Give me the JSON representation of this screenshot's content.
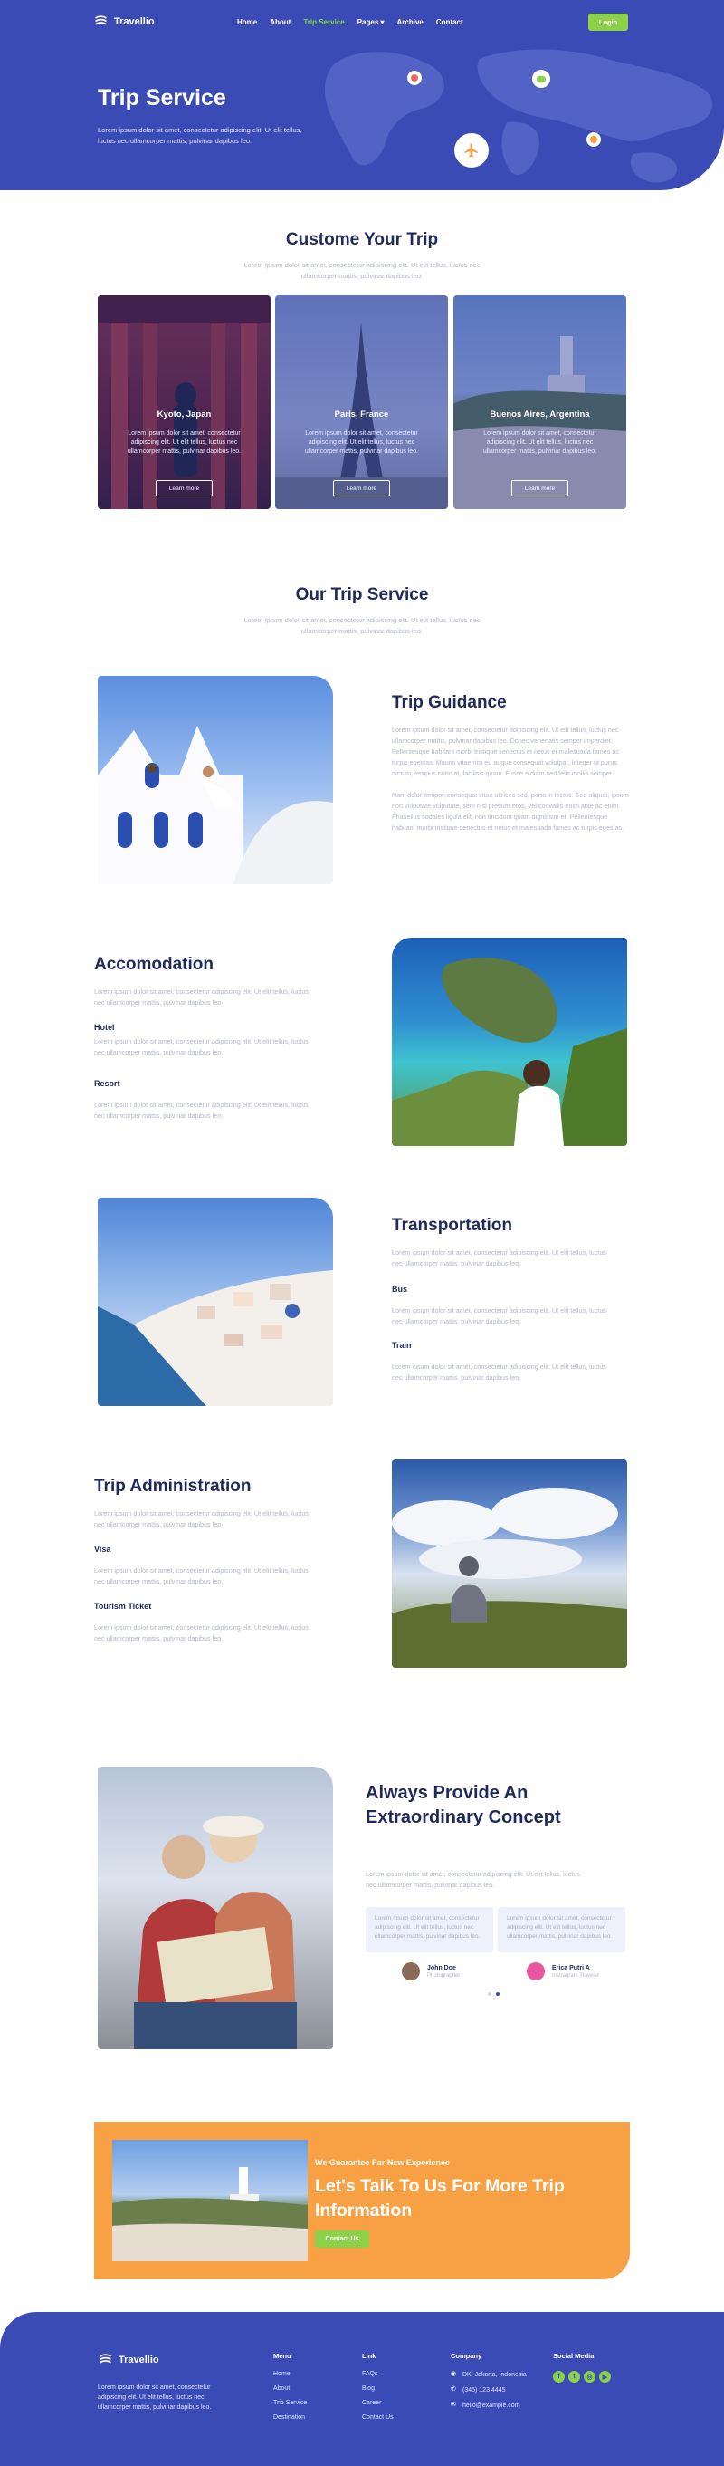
{
  "nav": {
    "brand": "Travellio",
    "links": [
      {
        "label": "Home"
      },
      {
        "label": "About"
      },
      {
        "label": "Trip Service"
      },
      {
        "label": "Pages"
      },
      {
        "label": "Archive"
      },
      {
        "label": "Contact"
      }
    ],
    "active_index": 2,
    "login_label": "Login"
  },
  "hero": {
    "title": "Trip Service",
    "subtitle": "Lorem ipsum dolor sit amet, consectetur adipiscing elit. Ut elit tellus, luctus nec ullamcorper mattis, pulvinar dapibus leo."
  },
  "customize": {
    "title": "Custome Your Trip",
    "subtitle": "Lorem ipsum dolor sit amet, consectetur adipiscing elit. Ut elit tellus, luctus nec ullamcorper mattis, pulvinar dapibus leo.",
    "cards": [
      {
        "title": "Kyoto, Japan",
        "text": "Lorem ipsum dolor sit amet, consectetur adipiscing elit. Ut elit tellus, luctus nec ullamcorper mattis, pulvinar dapibus leo.",
        "button": "Learn more"
      },
      {
        "title": "Paris, France",
        "text": "Lorem ipsum dolor sit amet, consectetur adipiscing elit. Ut elit tellus, luctus nec ullamcorper mattis, pulvinar dapibus leo.",
        "button": "Learn more"
      },
      {
        "title": "Buenos Aires, Argentina",
        "text": "Lorem ipsum dolor sit amet, consectetur adipiscing elit. Ut elit tellus, luctus nec ullamcorper mattis, pulvinar dapibus leo.",
        "button": "Learn more"
      }
    ]
  },
  "services": {
    "title": "Our Trip Service",
    "subtitle": "Lorem ipsum dolor sit amet, consectetur adipiscing elit. Ut elit tellus, luctus nec ullamcorper mattis, pulvinar dapibus leo.",
    "guidance": {
      "title": "Trip Guidance",
      "p1": "Lorem ipsum dolor sit amet, consectetur adipiscing elit. Ut elit tellus, luctus nec ullamcorper mattis, pulvinar dapibus leo. Donec venenatis semper imperdiet. Pellentesque habitant morbi tristique senectus et netus et malesuada fames ac turpis egestas. Mauris vitae nisi eu augue consequat volutpat. Integer ut purus dictum, tempus nunc at, facilisis quam. Fusce a diam sed felis mollis semper.",
      "p2": "Nam dolor tempor, consequat vitae ultrices sed, porta in lectus. Sed aliquet, ipsum non vulputate vulputate, sem nisl pretium eros, vel convallis enim ante ac enim. Phasellus sodales ligula elit, non tincidunt quam dignissim et. Pellentesque habitant morbi tristique senectus et netus et malesuada fames ac turpis egestas."
    },
    "accommodation": {
      "title": "Accomodation",
      "intro": "Lorem ipsum dolor sit amet, consectetur adipiscing elit. Ut elit tellus, luctus nec ullamcorper mattis, pulvinar dapibus leo.",
      "items": [
        {
          "label": "Hotel",
          "text": "Lorem ipsum dolor sit amet, consectetur adipiscing elit. Ut elit tellus, luctus nec ullamcorper mattis, pulvinar dapibus leo."
        },
        {
          "label": "Resort",
          "text": "Lorem ipsum dolor sit amet, consectetur adipiscing elit. Ut elit tellus, luctus nec ullamcorper mattis, pulvinar dapibus leo."
        }
      ]
    },
    "transportation": {
      "title": "Transportation",
      "intro": "Lorem ipsum dolor sit amet, consectetur adipiscing elit. Ut elit tellus, luctus nec ullamcorper mattis, pulvinar dapibus leo.",
      "items": [
        {
          "label": "Bus",
          "text": "Lorem ipsum dolor sit amet, consectetur adipiscing elit. Ut elit tellus, luctus nec ullamcorper mattis, pulvinar dapibus leo."
        },
        {
          "label": "Train",
          "text": "Lorem ipsum dolor sit amet, consectetur adipiscing elit. Ut elit tellus, luctus nec ullamcorper mattis, pulvinar dapibus leo."
        }
      ]
    },
    "administration": {
      "title": "Trip Administration",
      "intro": "Lorem ipsum dolor sit amet, consectetur adipiscing elit. Ut elit tellus, luctus nec ullamcorper mattis, pulvinar dapibus leo.",
      "items": [
        {
          "label": "Visa",
          "text": "Lorem ipsum dolor sit amet, consectetur adipiscing elit. Ut elit tellus, luctus nec ullamcorper mattis, pulvinar dapibus leo."
        },
        {
          "label": "Tourism Ticket",
          "text": "Lorem ipsum dolor sit amet, consectetur adipiscing elit. Ut elit tellus, luctus nec ullamcorper mattis, pulvinar dapibus leo."
        }
      ]
    }
  },
  "testimonial": {
    "title": "Always Provide An Extraordinary Concept",
    "subtitle": "Lorem ipsum dolor sit amet, consectetur adipiscing elit. Ut elit tellus, luctus nec ullamcorper mattis, pulvinar dapibus leo.",
    "quotes": [
      {
        "text": "Lorem ipsum dolor sit amet, consectetur adipiscing elit. Ut elit tellus, luctus nec ullamcorper mattis, pulvinar dapibus leo.",
        "name": "John Doe",
        "role": "Photographer"
      },
      {
        "text": "Lorem ipsum dolor sit amet, consectetur adipiscing elit. Ut elit tellus, luctus nec ullamcorper mattis, pulvinar dapibus leo.",
        "name": "Erica Putri A",
        "role": "Instragram Traveler"
      }
    ],
    "active_dot": 1
  },
  "cta": {
    "kicker": "We Guarantee For New Experience",
    "title": "Let's Talk To Us For More Trip Information",
    "button": "Contact Us"
  },
  "footer": {
    "brand": "Travellio",
    "about": "Lorem ipsum dolor sit amet, consectetur adipiscing elit. Ut elit tellus, luctus nec ullamcorper mattis, pulvinar dapibus leo.",
    "menu": {
      "title": "Menu",
      "items": [
        "Home",
        "About",
        "Trip Service",
        "Destination"
      ]
    },
    "link": {
      "title": "Link",
      "items": [
        "FAQs",
        "Blog",
        "Career",
        "Contact Us"
      ]
    },
    "company": {
      "title": "Company",
      "items": [
        {
          "icon": "location-icon",
          "text": "DKI Jakarta, Indonesia"
        },
        {
          "icon": "phone-icon",
          "text": "(345) 123 4445"
        },
        {
          "icon": "mail-icon",
          "text": "hello@example.com"
        }
      ]
    },
    "social": {
      "title": "Social Media",
      "icons": [
        "facebook-icon",
        "twitter-icon",
        "instagram-icon",
        "youtube-icon"
      ]
    }
  },
  "colors": {
    "primary": "#3b4bb5",
    "accent": "#8bd24a",
    "orange": "#f8a144",
    "heading": "#1f2a5a",
    "muted": "#b2b7c9"
  }
}
